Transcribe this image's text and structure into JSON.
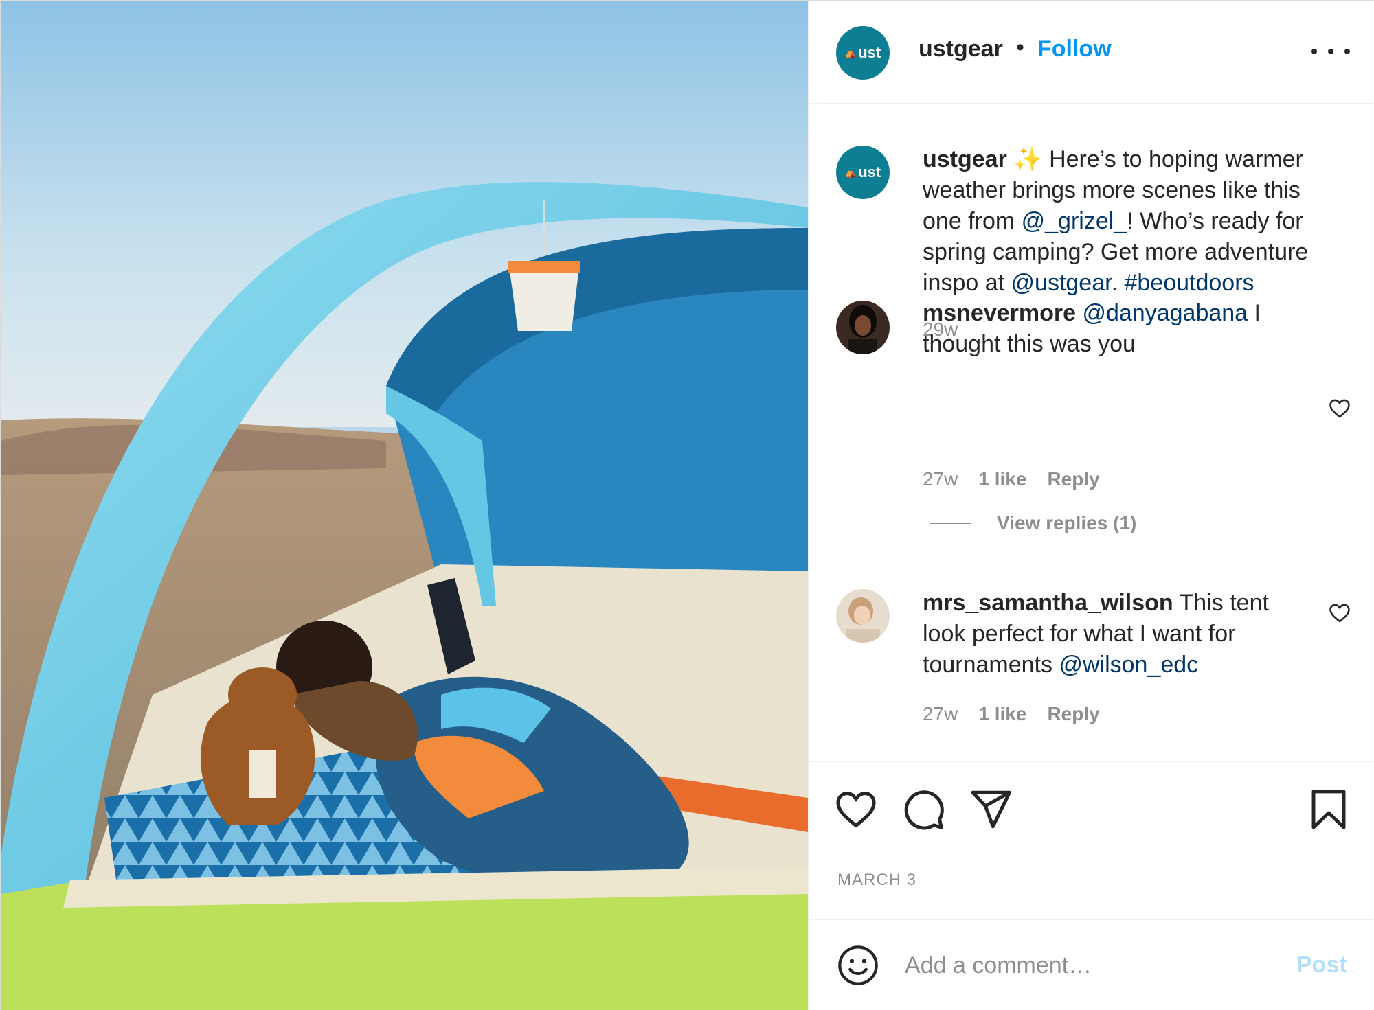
{
  "post": {
    "author": {
      "username": "ustgear",
      "avatar_text": "ust",
      "avatar_color": "#0d7e93"
    },
    "follow_label": "Follow",
    "separator": "•",
    "more_icon": "more-options-icon",
    "photo": {
      "description_icon": "camping-photo"
    }
  },
  "caption": {
    "username": "ustgear",
    "emoji": "✨",
    "text_1": " Here’s to hoping warmer weather brings more scenes like this one from ",
    "mention_1": "@_grizel_",
    "text_2": "! Who’s ready for spring camping? Get more adventure inspo at ",
    "mention_2": "@ustgear",
    "text_3": ". ",
    "hashtag": "#beoutdoors",
    "time": "29w"
  },
  "comments": [
    {
      "username": "msnevermore",
      "mention": "@danyagabana",
      "text": " I thought this was you",
      "time": "27w",
      "likes": "1 like",
      "reply": "Reply",
      "view_replies": "View replies (1)"
    },
    {
      "username": "mrs_samantha_wilson",
      "text_1": " This tent look perfect for what I want for tournaments ",
      "mention": "@wilson_edc",
      "time": "27w",
      "likes": "1 like",
      "reply": "Reply"
    }
  ],
  "actions": {
    "icons": [
      "heart-icon",
      "comment-icon",
      "share-icon",
      "bookmark-icon"
    ],
    "date": "MARCH 3"
  },
  "add_comment": {
    "placeholder": "Add a comment…",
    "post_label": "Post",
    "emoji_icon": "smiley-icon"
  },
  "colors": {
    "link_blue": "#0095f6",
    "mention_blue": "#00376b",
    "muted_gray": "#8e8e8e",
    "post_disabled": "#b2dffc"
  }
}
